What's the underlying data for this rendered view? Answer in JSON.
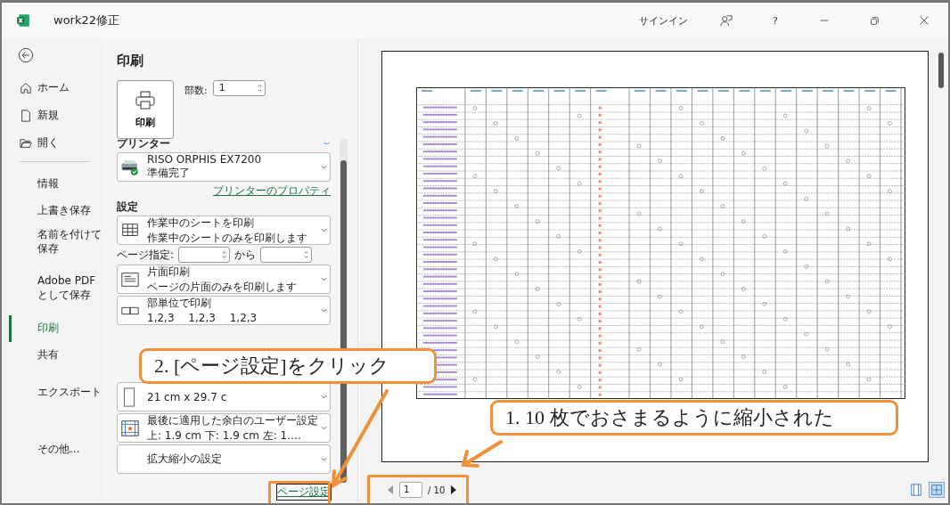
{
  "window": {
    "title": "work22修正",
    "signin": "サインイン",
    "help": "?"
  },
  "nav": {
    "top_items": [
      {
        "label": "ホーム"
      },
      {
        "label": "新規"
      },
      {
        "label": "開く"
      }
    ],
    "items": [
      {
        "label": "情報",
        "selected": false
      },
      {
        "label": "上書き保存",
        "selected": false
      },
      {
        "label": "名前を付けて保存",
        "selected": false
      },
      {
        "label": "Adobe PDF として保存",
        "selected": false
      },
      {
        "label": "印刷",
        "selected": true
      },
      {
        "label": "共有",
        "selected": false
      },
      {
        "label": "エクスポート",
        "selected": false
      },
      {
        "label": "その他...",
        "selected": false
      }
    ]
  },
  "print": {
    "title": "印刷",
    "button": "印刷",
    "copies_label": "部数:",
    "copies": "1"
  },
  "printer": {
    "heading": "プリンター",
    "name": "RISO ORPHIS EX7200",
    "status": "準備完了",
    "properties_link": "プリンターのプロパティ"
  },
  "settings": {
    "heading": "設定",
    "pages_label": "ページ指定:",
    "to_label": "から",
    "options": [
      {
        "kind": "sheets",
        "line1": "作業中のシートを印刷",
        "line2": "作業中のシートのみを印刷します"
      },
      {
        "kind": "sides",
        "line1": "片面印刷",
        "line2": "ページの片面のみを印刷します"
      },
      {
        "kind": "collate",
        "line1": "部単位で印刷",
        "line2": "1,2,3　 1,2,3　 1,2,3"
      },
      {
        "kind": "paper",
        "line2": "21 cm x 29.7 c"
      },
      {
        "kind": "margins",
        "line1": "最後に適用した余白のユーザー設定",
        "line2": "上: 1.9 cm 下: 1.9 cm 左: 1.…"
      },
      {
        "kind": "scaling",
        "line1": "拡大縮小の設定"
      }
    ]
  },
  "page_setup_link": "ページ設定",
  "pager": {
    "page": "1",
    "total": "/ 10"
  },
  "callouts": [
    {
      "text": "2. [ページ設定]をクリック"
    },
    {
      "text": "1. 10 枚でおさまるように縮小された"
    }
  ]
}
